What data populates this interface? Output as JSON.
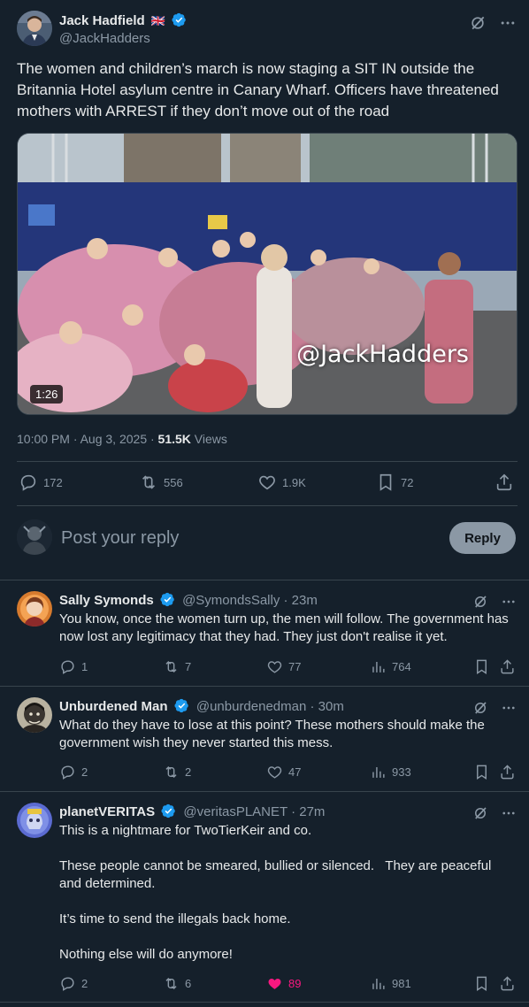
{
  "tweet": {
    "author_name": "Jack Hadfield",
    "author_flag": "🇬🇧",
    "author_handle": "@JackHadders",
    "text": "The women and children’s march is now staging a SIT IN outside the Britannia Hotel asylum centre in Canary Wharf. Officers have threatened mothers with ARREST if they don’t move out of the road",
    "video": {
      "duration": "1:26",
      "watermark": "@JackHadders"
    },
    "timestamp": "10:00 PM · Aug 3, 2025 · ",
    "views_count": "51.5K",
    "views_label": " Views",
    "stats": {
      "replies": "172",
      "reposts": "556",
      "likes": "1.9K",
      "bookmarks": "72"
    }
  },
  "reply_box": {
    "placeholder": "Post your reply",
    "button_label": "Reply"
  },
  "replies": [
    {
      "name": "Sally Symonds",
      "handle": "@SymondsSally · 23m",
      "paragraphs": [
        "You know, once the women turn up, the men will follow. The government has now lost any legitimacy that they had. They just don't realise it yet."
      ],
      "stats": {
        "replies": "1",
        "reposts": "7",
        "likes": "77",
        "views": "764"
      }
    },
    {
      "name": "Unburdened Man",
      "handle": "@unburdenedman · 30m",
      "paragraphs": [
        "What do they have to lose at this point? These mothers should make the government wish they never started this mess."
      ],
      "stats": {
        "replies": "2",
        "reposts": "2",
        "likes": "47",
        "views": "933"
      }
    },
    {
      "name": "planetVERITAS",
      "handle": "@veritasPLANET · 27m",
      "paragraphs": [
        "This is a nightmare for TwoTierKeir and co.",
        "These people cannot be smeared, bullied or silenced.   They are peaceful and determined.",
        "It’s time to send the illegals back home.",
        "Nothing else will do anymore!"
      ],
      "stats": {
        "replies": "2",
        "reposts": "6",
        "likes": "89",
        "views": "981"
      }
    }
  ],
  "colors": {
    "background": "#15202b",
    "text": "#e7e9ea",
    "muted": "#8b98a5",
    "verified": "#1d9bf0",
    "like_active": "#f91880",
    "divider": "#38444d"
  },
  "icons": {
    "verified": "verified-badge-icon",
    "grok": "grok-icon",
    "more": "more-icon",
    "reply": "reply-icon",
    "repost": "repost-icon",
    "like": "heart-icon",
    "views": "views-icon",
    "bookmark": "bookmark-icon",
    "share": "share-icon"
  }
}
